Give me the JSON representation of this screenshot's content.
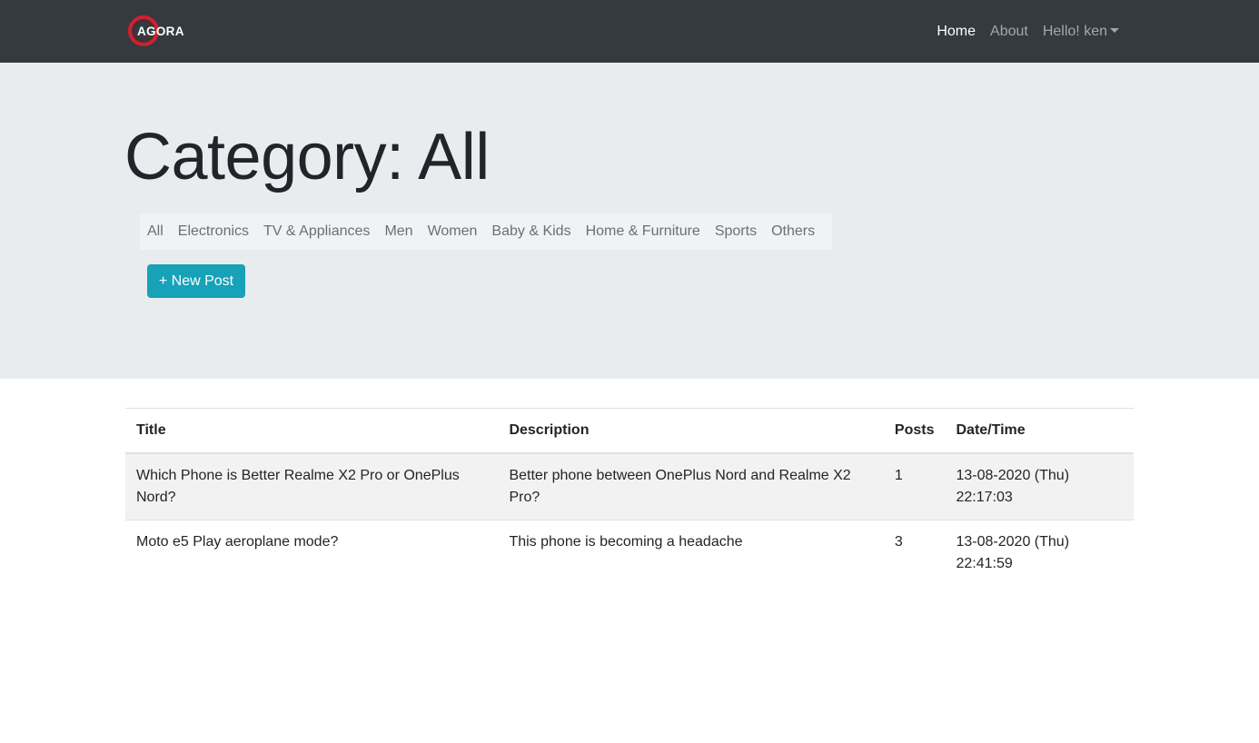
{
  "navbar": {
    "brand": "AGORA",
    "links": [
      {
        "label": "Home",
        "active": true
      },
      {
        "label": "About",
        "active": false
      }
    ],
    "user_menu": "Hello! ken",
    "colors": {
      "background": "#343a40",
      "logo_ring": "#d0202e"
    }
  },
  "header": {
    "title": "Category: All",
    "categories": [
      "All",
      "Electronics",
      "TV & Appliances",
      "Men",
      "Women",
      "Baby & Kids",
      "Home & Furniture",
      "Sports",
      "Others"
    ],
    "new_post_label": "+ New Post",
    "accent": "#17a2b8"
  },
  "table": {
    "columns": [
      "Title",
      "Description",
      "Posts",
      "Date/Time"
    ],
    "rows": [
      {
        "title": "Which Phone is Better Realme X2 Pro or OnePlus Nord?",
        "description": "Better phone between OnePlus Nord and Realme X2 Pro?",
        "posts": "1",
        "datetime": "13-08-2020 (Thu) 22:17:03"
      },
      {
        "title": "Moto e5 Play aeroplane mode?",
        "description": "This phone is becoming a headache",
        "posts": "3",
        "datetime": "13-08-2020 (Thu) 22:41:59"
      }
    ]
  }
}
